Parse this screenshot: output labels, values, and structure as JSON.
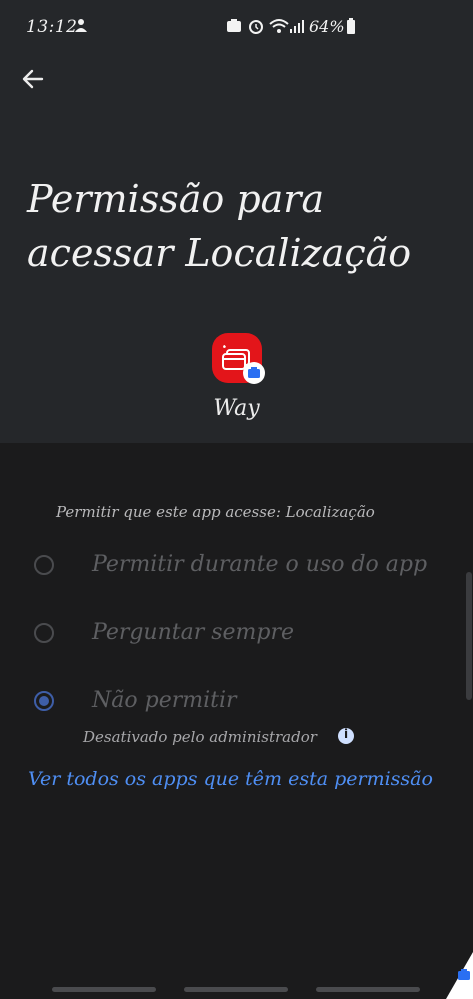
{
  "status_bar": {
    "time": "13:12",
    "battery_percent": "64%"
  },
  "header": {
    "back_icon": "arrow-left-icon"
  },
  "title": {
    "line1": "Permissão para",
    "line2": "acessar Localização"
  },
  "app": {
    "name": "Way",
    "icon": "card-wallet-icon",
    "badge_icon": "work-profile-badge-icon"
  },
  "permission": {
    "question": "Permitir que este app acesse: Localização",
    "options": [
      {
        "label": "Permitir durante o uso do app",
        "selected": false
      },
      {
        "label": "Perguntar sempre",
        "selected": false
      },
      {
        "label": "Não permitir",
        "selected": true
      }
    ],
    "disabled_note": "Desativado pelo administrador"
  },
  "see_all_link": "Ver todos os apps que têm esta permissão",
  "colors": {
    "background": "#1b1b1c",
    "header_bg": "#25272a",
    "accent": "#4f8ff4",
    "radio_selected": "#3e5ea8",
    "app_icon": "#e3151a"
  }
}
